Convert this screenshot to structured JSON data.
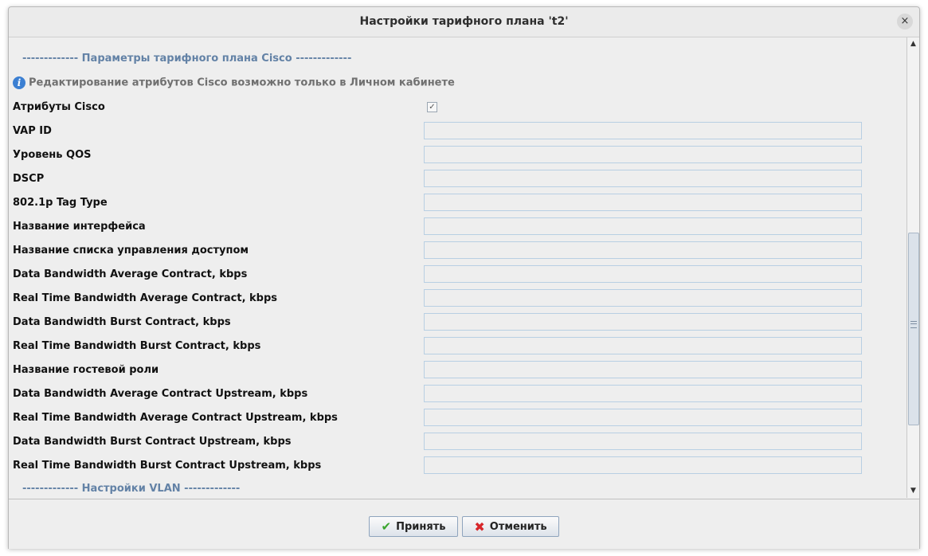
{
  "dialog": {
    "title": "Настройки тарифного плана 't2'",
    "close_icon": "×"
  },
  "form": {
    "section_cisco": "------------- Параметры тарифного плана Cisco -------------",
    "info_icon": "i",
    "info_text": "Редактирование атрибутов Cisco возможно только в Личном кабинете",
    "cisco_attrs_label": "Атрибуты Cisco",
    "cisco_attrs_checked": true,
    "checkmark": "✓",
    "fields": [
      {
        "label": "VAP ID",
        "value": ""
      },
      {
        "label": "Уровень QOS",
        "value": ""
      },
      {
        "label": "DSCP",
        "value": ""
      },
      {
        "label": "802.1p Tag Type",
        "value": ""
      },
      {
        "label": "Название интерфейса",
        "value": ""
      },
      {
        "label": "Название списка управления доступом",
        "value": ""
      },
      {
        "label": "Data Bandwidth Average Contract, kbps",
        "value": ""
      },
      {
        "label": "Real Time Bandwidth Average Contract, kbps",
        "value": ""
      },
      {
        "label": "Data Bandwidth Burst Contract, kbps",
        "value": ""
      },
      {
        "label": "Real Time Bandwidth Burst Contract, kbps",
        "value": ""
      },
      {
        "label": "Название гостевой роли",
        "value": ""
      },
      {
        "label": "Data Bandwidth Average Contract Upstream, kbps",
        "value": ""
      },
      {
        "label": "Real Time Bandwidth Average Contract Upstream, kbps",
        "value": ""
      },
      {
        "label": "Data Bandwidth Burst Contract Upstream, kbps",
        "value": ""
      },
      {
        "label": "Real Time Bandwidth Burst Contract Upstream, kbps",
        "value": ""
      }
    ],
    "section_vlan": "------------- Настройки VLAN -------------"
  },
  "scrollbar": {
    "up_arrow": "▲",
    "down_arrow": "▼",
    "position_fraction": 0.5
  },
  "footer": {
    "ok_icon": "✔",
    "ok_label": "Принять",
    "cancel_icon": "✖",
    "cancel_label": "Отменить"
  },
  "colors": {
    "section_header": "#6382a6",
    "info_icon": "#3b7fd2",
    "ok_icon": "#3aa52e",
    "cancel_icon": "#d7262b"
  }
}
